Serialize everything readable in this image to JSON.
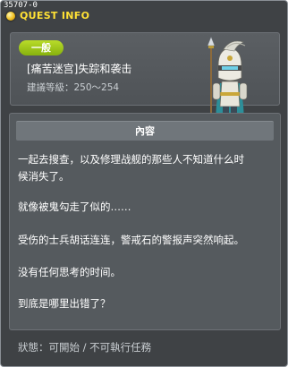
{
  "window": {
    "quest_id": "35707-0",
    "title": "QUEST INFO"
  },
  "header": {
    "category": "一般",
    "quest_name": "[痛苦迷宫]失踪和袭击",
    "level_range": "建議等級：250～254"
  },
  "content": {
    "heading": "內容",
    "paragraphs": [
      [
        "一起去搜查，以及修理战舰的那些人不知道什么时",
        "候消失了。"
      ],
      [
        "就像被鬼勾走了似的……"
      ],
      [
        "受伤的士兵胡话连连，警戒石的警报声突然响起。"
      ],
      [
        "没有任何思考的时间。"
      ],
      [
        "到底是哪里出错了？"
      ]
    ]
  },
  "footer": {
    "status": "狀態：可開始 / 不可執行任務"
  },
  "colors": {
    "title_accent": "#ffe135",
    "tag_green": "#9cc81a",
    "window_bg": "#3f4245",
    "panel_bg": "#555a5e"
  },
  "icons": {
    "title_icon": "quest-coin-icon",
    "npc_portrait": "armored-knight-with-spear"
  }
}
